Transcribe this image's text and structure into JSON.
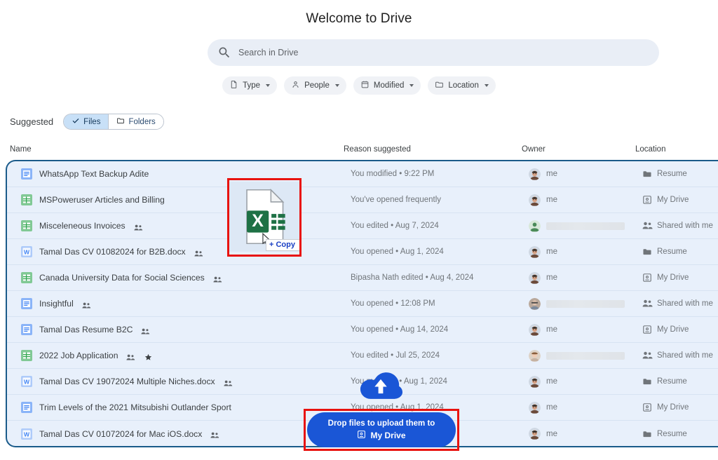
{
  "header": {
    "title": "Welcome to Drive"
  },
  "search": {
    "icon": "search-icon",
    "placeholder": "Search in Drive"
  },
  "filter_chips": [
    {
      "label": "Type",
      "icon": "file-icon"
    },
    {
      "label": "People",
      "icon": "person-icon"
    },
    {
      "label": "Modified",
      "icon": "calendar-icon"
    },
    {
      "label": "Location",
      "icon": "folder-icon"
    }
  ],
  "suggested": {
    "label": "Suggested",
    "segments": [
      {
        "label": "Files",
        "icon": "check-icon",
        "active": true
      },
      {
        "label": "Folders",
        "icon": "folder-icon",
        "active": false
      }
    ]
  },
  "table": {
    "columns": [
      "Name",
      "Reason suggested",
      "Owner",
      "Location"
    ],
    "rows": [
      {
        "name": "WhatsApp Text Backup Adite",
        "type": "docs",
        "shared": false,
        "starred": false,
        "reason": "You modified • 9:22 PM",
        "owner": "me",
        "owner_avatar": "photo",
        "owner_blurred": false,
        "location": "Resume",
        "location_icon": "folder-icon"
      },
      {
        "name": "MSPoweruser Articles and Billing",
        "type": "sheets",
        "shared": false,
        "starred": false,
        "reason": "You've opened frequently",
        "owner": "me",
        "owner_avatar": "photo",
        "owner_blurred": false,
        "location": "My Drive",
        "location_icon": "drive-icon"
      },
      {
        "name": "Misceleneous Invoices",
        "type": "sheets",
        "shared": true,
        "starred": false,
        "reason": "You edited • Aug 7, 2024",
        "owner": "",
        "owner_avatar": "green",
        "owner_blurred": true,
        "location": "Shared with me",
        "location_icon": "people-icon"
      },
      {
        "name": "Tamal Das CV 01082024 for B2B.docx",
        "type": "word",
        "shared": true,
        "starred": false,
        "reason": "You opened • Aug 1, 2024",
        "owner": "me",
        "owner_avatar": "photo",
        "owner_blurred": false,
        "location": "Resume",
        "location_icon": "folder-icon"
      },
      {
        "name": "Canada University Data for Social Sciences",
        "type": "sheets",
        "shared": true,
        "starred": false,
        "reason": "Bipasha Nath edited • Aug 4, 2024",
        "owner": "me",
        "owner_avatar": "photo",
        "owner_blurred": false,
        "location": "My Drive",
        "location_icon": "drive-icon"
      },
      {
        "name": "Insightful",
        "type": "docs",
        "shared": true,
        "starred": false,
        "reason": "You opened • 12:08 PM",
        "owner": "",
        "owner_avatar": "photo2",
        "owner_blurred": true,
        "location": "Shared with me",
        "location_icon": "people-icon"
      },
      {
        "name": "Tamal Das Resume B2C",
        "type": "docs",
        "shared": true,
        "starred": false,
        "reason": "You opened • Aug 14, 2024",
        "owner": "me",
        "owner_avatar": "photo",
        "owner_blurred": false,
        "location": "My Drive",
        "location_icon": "drive-icon"
      },
      {
        "name": "2022 Job Application",
        "type": "sheets",
        "shared": true,
        "starred": true,
        "reason": "You edited • Jul 25, 2024",
        "owner": "",
        "owner_avatar": "photo3",
        "owner_blurred": true,
        "location": "Shared with me",
        "location_icon": "people-icon"
      },
      {
        "name": "Tamal Das CV 19072024 Multiple Niches.docx",
        "type": "word",
        "shared": true,
        "starred": false,
        "reason": "You modified • Aug 1, 2024",
        "owner": "me",
        "owner_avatar": "photo",
        "owner_blurred": false,
        "location": "Resume",
        "location_icon": "folder-icon"
      },
      {
        "name": "Trim Levels of the 2021 Mitsubishi Outlander Sport",
        "type": "docs",
        "shared": false,
        "starred": false,
        "reason": "You opened • Aug 1, 2024",
        "owner": "me",
        "owner_avatar": "photo",
        "owner_blurred": false,
        "location": "My Drive",
        "location_icon": "drive-icon"
      },
      {
        "name": "Tamal Das CV 01072024 for Mac iOS.docx",
        "type": "word",
        "shared": true,
        "starred": false,
        "reason": "",
        "owner": "me",
        "owner_avatar": "photo",
        "owner_blurred": false,
        "location": "Resume",
        "location_icon": "folder-icon"
      }
    ]
  },
  "drag": {
    "ghost_icon": "excel-file-icon",
    "cursor": "arrow-cursor",
    "copy_badge": "Copy",
    "plus": "+"
  },
  "drop_overlay": {
    "cloud_icon": "cloud-upload-icon",
    "line1": "Drop files to upload them to",
    "destination_icon": "drive-icon",
    "destination": "My Drive"
  },
  "colors": {
    "accent_blue": "#1a56d6",
    "annotation_red": "#e8130f",
    "drop_border": "#1a5b8a",
    "row_bg": "#e8f0fb",
    "chip_bg": "#f0f2f6",
    "search_bg": "#e9eef6"
  }
}
